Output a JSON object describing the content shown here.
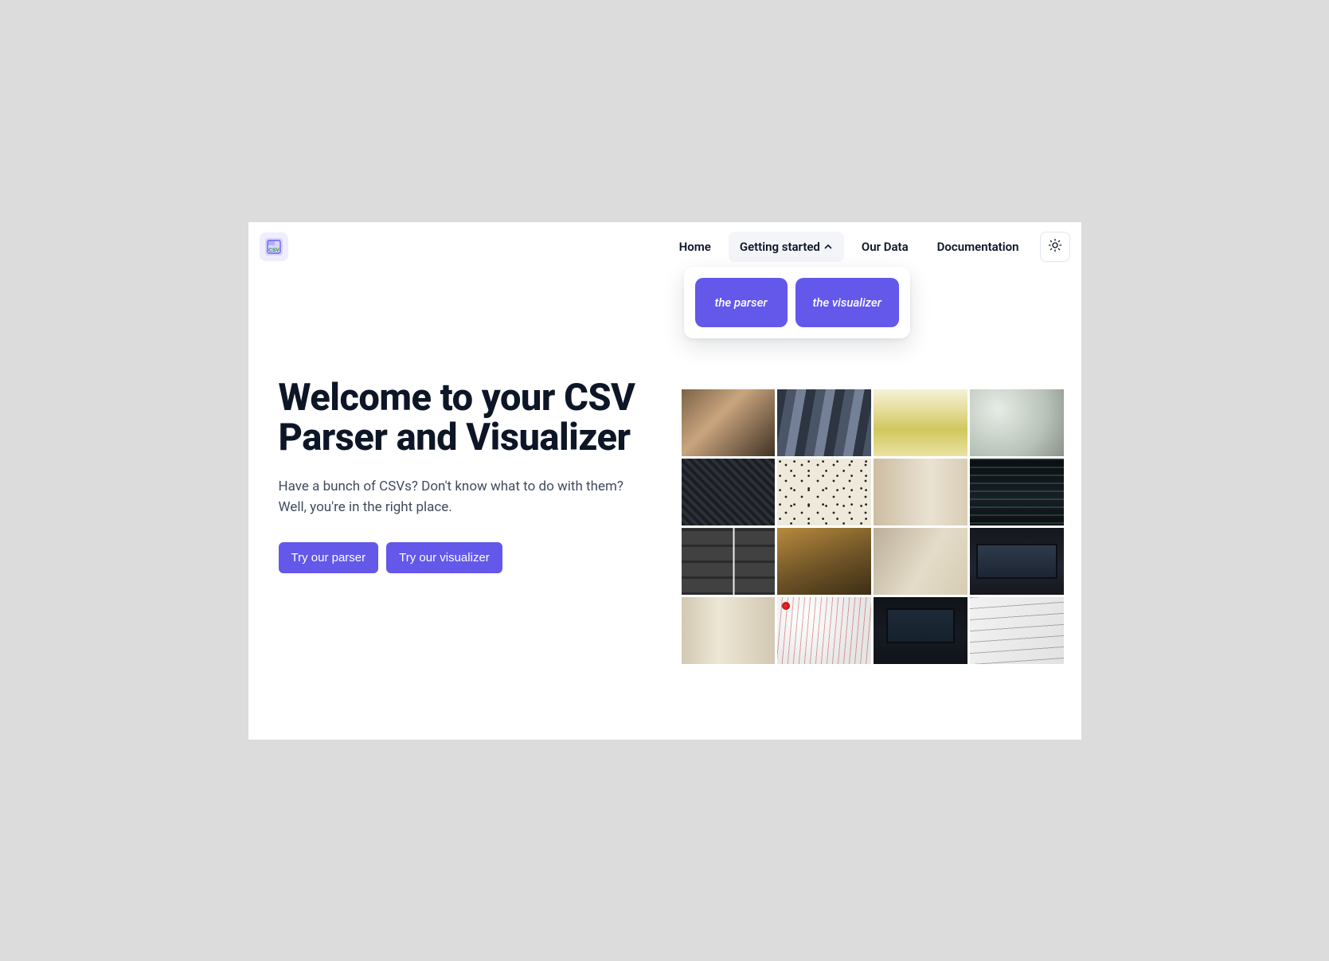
{
  "nav": {
    "items": [
      "Home",
      "Getting started",
      "Our Data",
      "Documentation"
    ],
    "active_index": 1
  },
  "dropdown": {
    "items": [
      "the parser",
      "the visualizer"
    ]
  },
  "hero": {
    "title": "Welcome to your CSV Parser and Visualizer",
    "subtitle": "Have a bunch of CSVs? Don't know what to do with them? Well, you're in the right place."
  },
  "cta": {
    "primary": "Try our parser",
    "secondary": "Try our visualizer"
  },
  "logo": {
    "label": "CSV"
  },
  "colors": {
    "accent": "#6358ea"
  }
}
